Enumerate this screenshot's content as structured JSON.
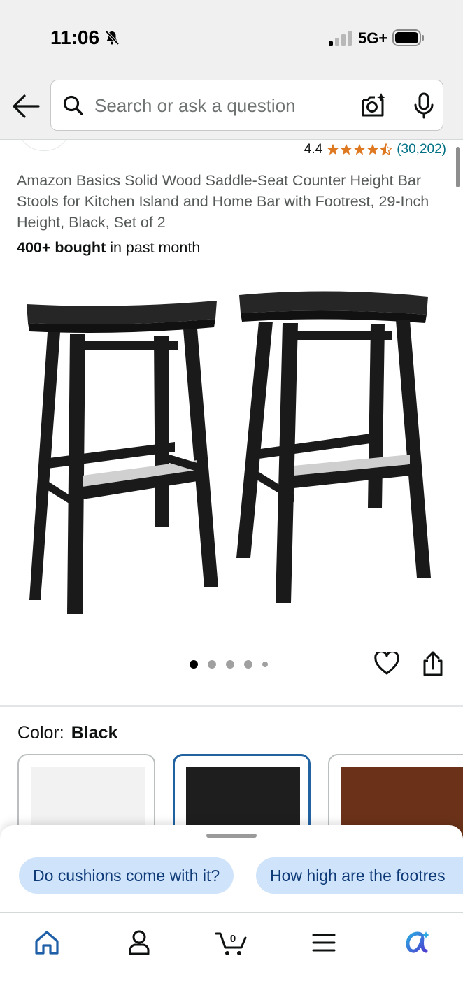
{
  "status_bar": {
    "time": "11:06",
    "network": "5G+",
    "icons": [
      "bell-slash-icon",
      "signal-icon",
      "battery-icon"
    ]
  },
  "header": {
    "search_placeholder": "Search or ask a question",
    "icons": [
      "back-arrow-icon",
      "search-icon",
      "camera-icon",
      "mic-icon"
    ]
  },
  "product": {
    "rating": "4.4",
    "stars": 4.5,
    "review_count": "(30,202)",
    "title": "Amazon Basics Solid Wood Saddle-Seat Counter Height Bar Stools for Kitchen Island and Home Bar with Footrest, 29-Inch Height, Black, Set of 2",
    "bought_bold": "400+ bought",
    "bought_rest": " in past month",
    "image_count": 5,
    "active_image_index": 0
  },
  "color": {
    "label": "Color:",
    "selected": "Black",
    "swatches": [
      {
        "name": "White",
        "hex": "#f2f2f2",
        "selected": false
      },
      {
        "name": "Black",
        "hex": "#1e1e1e",
        "selected": true
      },
      {
        "name": "Walnut",
        "hex": "#6b3219",
        "selected": false
      }
    ]
  },
  "suggestions": {
    "chips": [
      "Do cushions come with it?",
      "How high are the footres"
    ]
  },
  "tab_bar": {
    "cart_count": "0",
    "tabs": [
      "home-icon",
      "account-icon",
      "cart-icon",
      "menu-icon",
      "rufus-icon"
    ]
  },
  "colors": {
    "accent": "#2162a1",
    "star": "#de7921",
    "link": "#007185",
    "chip_bg": "#cfe4fb"
  }
}
